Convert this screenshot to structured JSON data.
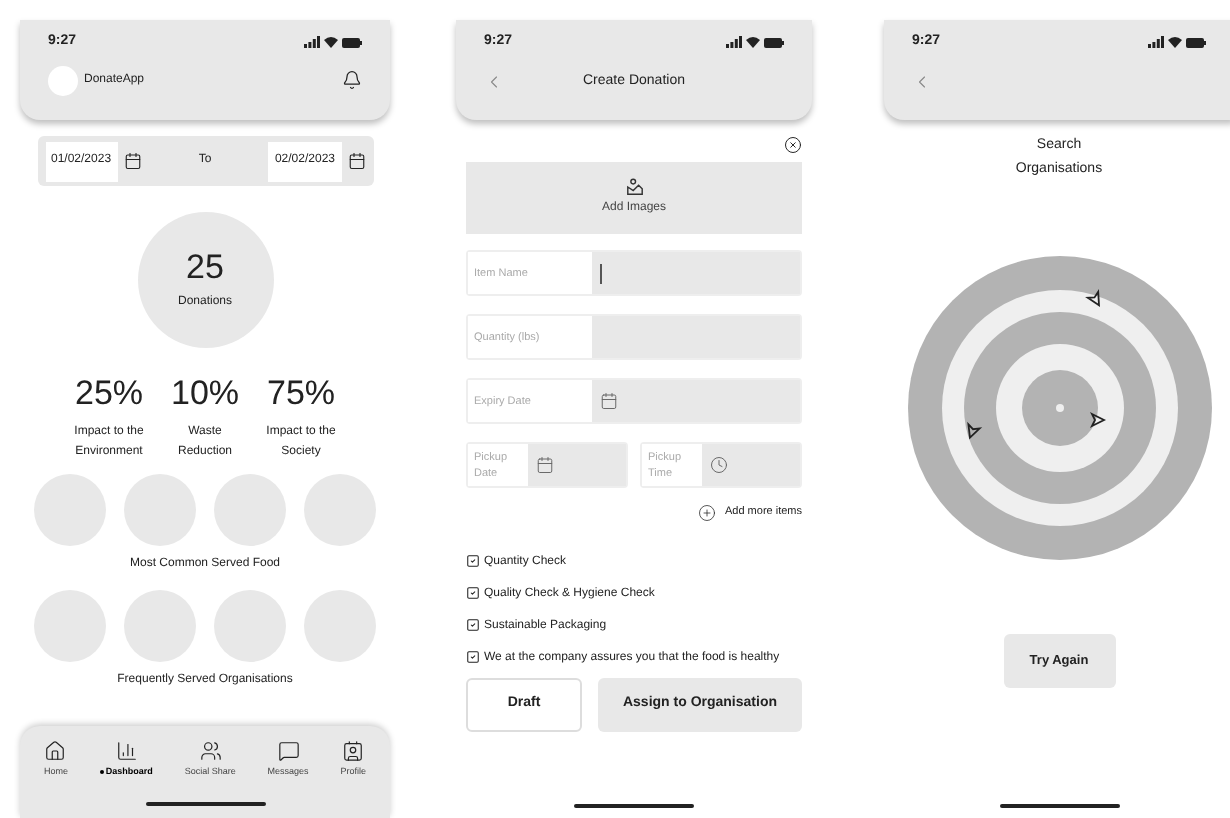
{
  "dashboard": {
    "status_time": "9:27",
    "app_name": "DonateApp",
    "date_from": "01/02/2023",
    "date_separator": "To",
    "date_to": "02/02/2023",
    "donations_count": "25",
    "donations_label": "Donations",
    "stats": [
      {
        "value": "25%",
        "label": "Impact to the Environment"
      },
      {
        "value": "10%",
        "label": "Waste Reduction"
      },
      {
        "value": "75%",
        "label": "Impact to the Society"
      }
    ],
    "food_section_title": "Most Common Served Food",
    "organisations_section_title": "Frequently Served Organisations",
    "nav": [
      {
        "label": "Home",
        "selected": false
      },
      {
        "label": "Dashboard",
        "selected": true
      },
      {
        "label": "Social Share",
        "selected": false
      },
      {
        "label": "Messages",
        "selected": false
      },
      {
        "label": "Profile",
        "selected": false
      }
    ]
  },
  "create_donation": {
    "status_time": "9:27",
    "title": "Create Donation",
    "add_images": "Add Images",
    "field_rows": [
      [
        {
          "kind": "text",
          "label": "Item Name",
          "focused": true
        }
      ],
      [
        {
          "kind": "text",
          "label": "Quantity (lbs)",
          "focused": false
        }
      ],
      [
        {
          "kind": "date",
          "label": "Expiry Date",
          "focused": false
        }
      ],
      [
        {
          "kind": "date",
          "label": "Pickup Date",
          "focused": false
        },
        {
          "kind": "time",
          "label": "Pickup Time",
          "focused": false
        }
      ]
    ],
    "add_more": "Add more items",
    "checks": [
      {
        "label": "Quantity Check",
        "checked": true
      },
      {
        "label": "Quality Check & Hygiene Check",
        "checked": true
      },
      {
        "label": "Sustainable Packaging",
        "checked": true
      },
      {
        "label": "We at the company assures you that the food is healthy",
        "checked": true
      }
    ],
    "draft_button": "Draft",
    "assign_button": "Assign to Organisation"
  },
  "search_organisations": {
    "status_time": "9:27",
    "title": "Search Organisations",
    "try_again": "Try Again"
  }
}
